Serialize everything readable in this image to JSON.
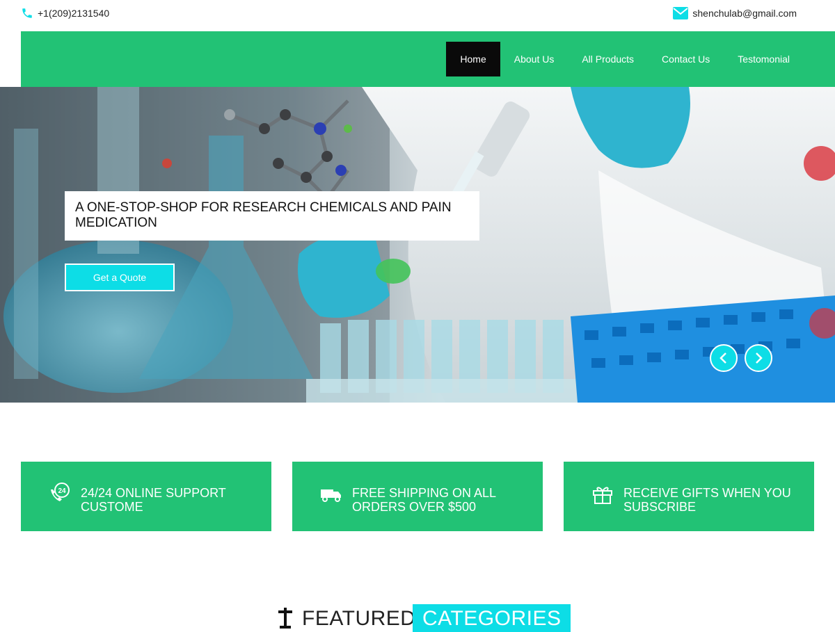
{
  "contact": {
    "phone": "+1(209)2131540",
    "email": "shenchulab@gmail.com"
  },
  "nav": {
    "items": [
      {
        "label": "Home",
        "active": true
      },
      {
        "label": "About Us"
      },
      {
        "label": "All Products"
      },
      {
        "label": "Contact Us"
      },
      {
        "label": "Testomonial"
      }
    ]
  },
  "hero": {
    "title": "A ONE-STOP-SHOP FOR RESEARCH CHEMICALS AND PAIN MEDICATION",
    "button": "Get a Quote"
  },
  "features": [
    {
      "icon": "phone-24-icon",
      "text": "24/24 ONLINE SUPPORT CUSTOME"
    },
    {
      "icon": "truck-icon",
      "text": "FREE SHIPPING ON ALL ORDERS OVER $500"
    },
    {
      "icon": "gift-icon",
      "text": "RECEIVE GIFTS WHEN YOU SUBSCRIBE"
    }
  ],
  "featured": {
    "word1": "FEATURED",
    "word2": "CATEGORIES"
  },
  "colors": {
    "brand_green": "#22c275",
    "accent_cyan": "#0ddde6",
    "nav_active": "#0a0a0a"
  }
}
